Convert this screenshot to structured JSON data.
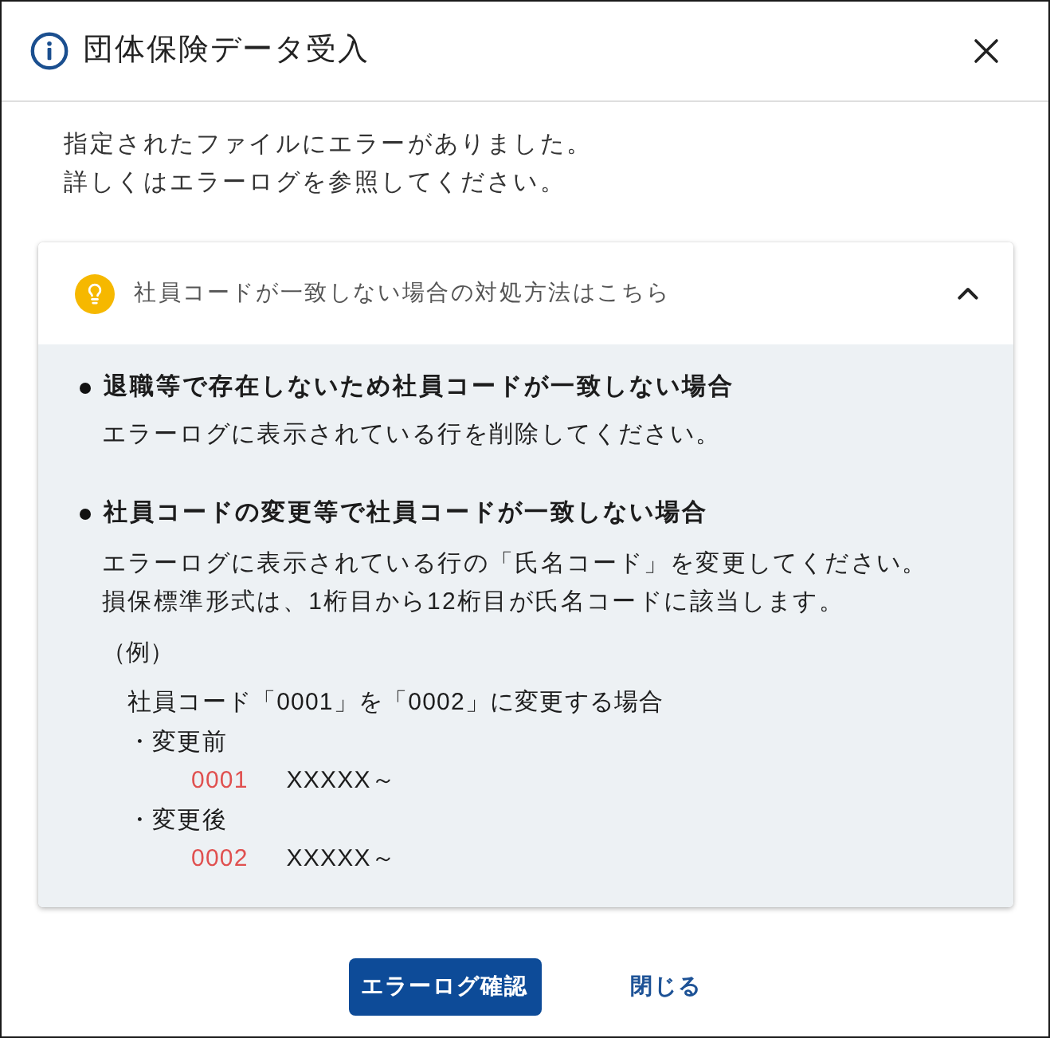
{
  "dialog": {
    "title": "団体保険データ受入"
  },
  "message": [
    "指定されたファイルにエラーがありました。",
    "詳しくはエラーログを参照してください。"
  ],
  "accordion": {
    "title": "社員コードが一致しない場合の対処方法はこちら",
    "expanded": true,
    "sections": [
      {
        "heading": "退職等で存在しないため社員コードが一致しない場合",
        "lines": [
          "エラーログに表示されている行を削除してください。"
        ]
      },
      {
        "heading": "社員コードの変更等で社員コードが一致しない場合",
        "lines": [
          "エラーログに表示されている行の「氏名コード」を変更してください。",
          "損保標準形式は、1桁目から12桁目が氏名コードに該当します。"
        ],
        "example": {
          "label": "（例）",
          "description": "社員コード「0001」を「0002」に変更する場合",
          "cases": [
            {
              "label": "・変更前",
              "code": "0001",
              "value": "XXXXX～"
            },
            {
              "label": "・変更後",
              "code": "0002",
              "value": "XXXXX～"
            }
          ]
        }
      }
    ]
  },
  "buttons": [
    {
      "label": "エラーログ確認",
      "kind": "primary"
    },
    {
      "label": "閉じる",
      "kind": "text"
    }
  ]
}
